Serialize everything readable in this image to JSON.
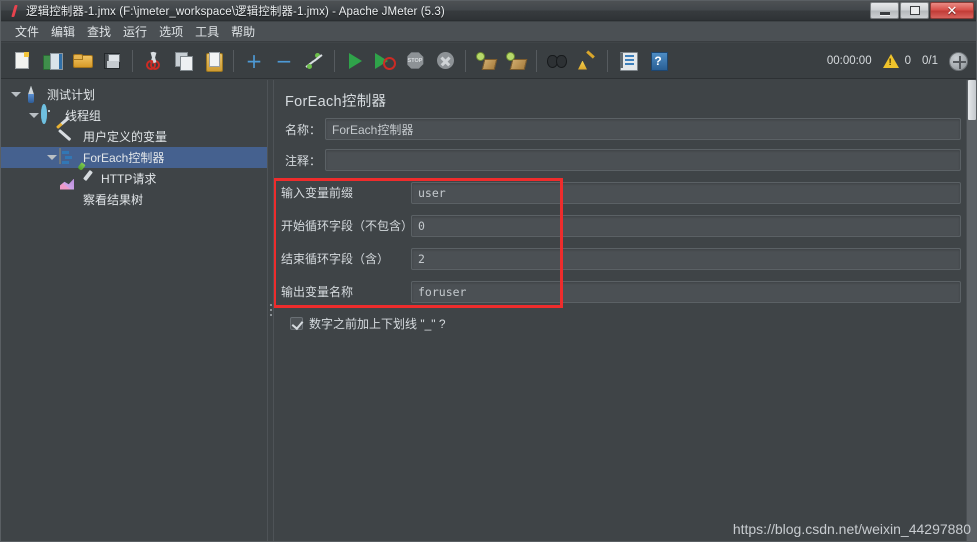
{
  "window": {
    "title": "逻辑控制器-1.jmx (F:\\jmeter_workspace\\逻辑控制器-1.jmx) - Apache JMeter (5.3)",
    "app_icon": "jmeter-feather-icon",
    "buttons": {
      "minimize": "minimize-button",
      "maximize": "maximize-button",
      "close_glyph": "✕"
    }
  },
  "menu": {
    "items": [
      {
        "label": "文件",
        "name": "menu-file"
      },
      {
        "label": "编辑",
        "name": "menu-edit"
      },
      {
        "label": "查找",
        "name": "menu-search"
      },
      {
        "label": "运行",
        "name": "menu-run"
      },
      {
        "label": "选项",
        "name": "menu-options"
      },
      {
        "label": "工具",
        "name": "menu-tools"
      },
      {
        "label": "帮助",
        "name": "menu-help"
      }
    ]
  },
  "toolbar": {
    "icons": [
      "new-icon",
      "templates-icon",
      "open-icon",
      "save-icon",
      "cut-icon",
      "copy-icon",
      "paste-icon",
      "expand-all-icon",
      "collapse-all-icon",
      "toggle-icon",
      "start-icon",
      "start-no-timers-icon",
      "stop-icon",
      "shutdown-icon",
      "clear-icon",
      "clear-all-icon",
      "search-icon",
      "reset-search-icon",
      "function-helper-icon",
      "help-icon"
    ],
    "stop_label": "STOP",
    "status": {
      "timer": "00:00:00",
      "warning_icon": "warning-triangle-icon",
      "warning_count": "0",
      "threads": "0/1",
      "thread_indicator_icon": "thread-activity-icon"
    }
  },
  "tree": {
    "nodes": [
      {
        "label": "测试计划",
        "icon": "test-plan-icon",
        "depth": 0,
        "expanded": true,
        "selected": false,
        "name": "tree-node-test-plan"
      },
      {
        "label": "线程组",
        "icon": "thread-group-icon",
        "depth": 1,
        "expanded": true,
        "selected": false,
        "name": "tree-node-thread-group"
      },
      {
        "label": "用户定义的变量",
        "icon": "user-defined-variables-icon",
        "depth": 2,
        "expanded": false,
        "selected": false,
        "name": "tree-node-user-defined-variables"
      },
      {
        "label": "ForEach控制器",
        "icon": "foreach-controller-icon",
        "depth": 2,
        "expanded": true,
        "selected": true,
        "name": "tree-node-foreach-controller"
      },
      {
        "label": "HTTP请求",
        "icon": "http-request-icon",
        "depth": 3,
        "expanded": false,
        "selected": false,
        "name": "tree-node-http-request"
      },
      {
        "label": "察看结果树",
        "icon": "view-results-tree-icon",
        "depth": 2,
        "expanded": false,
        "selected": false,
        "name": "tree-node-view-results-tree"
      }
    ]
  },
  "panel": {
    "title": "ForEach控制器",
    "name_label": "名称：",
    "name_value": "ForEach控制器",
    "comment_label": "注释：",
    "comment_value": "",
    "comment_placeholder": "",
    "fields": [
      {
        "label": "输入变量前缀",
        "value": "user",
        "name": "input-variable-prefix-field"
      },
      {
        "label": "开始循环字段（不包含）",
        "value": "0",
        "name": "start-index-field"
      },
      {
        "label": "结束循环字段（含）",
        "value": "2",
        "name": "end-index-field"
      },
      {
        "label": "输出变量名称",
        "value": "foruser",
        "name": "output-variable-name-field"
      }
    ],
    "checkbox": {
      "label": "数字之前加上下划线 \"_\" ?",
      "checked": true
    }
  },
  "annotation": {
    "highlight_color": "#ee2c2c"
  },
  "watermark": "https://blog.csdn.net/weixin_44297880"
}
